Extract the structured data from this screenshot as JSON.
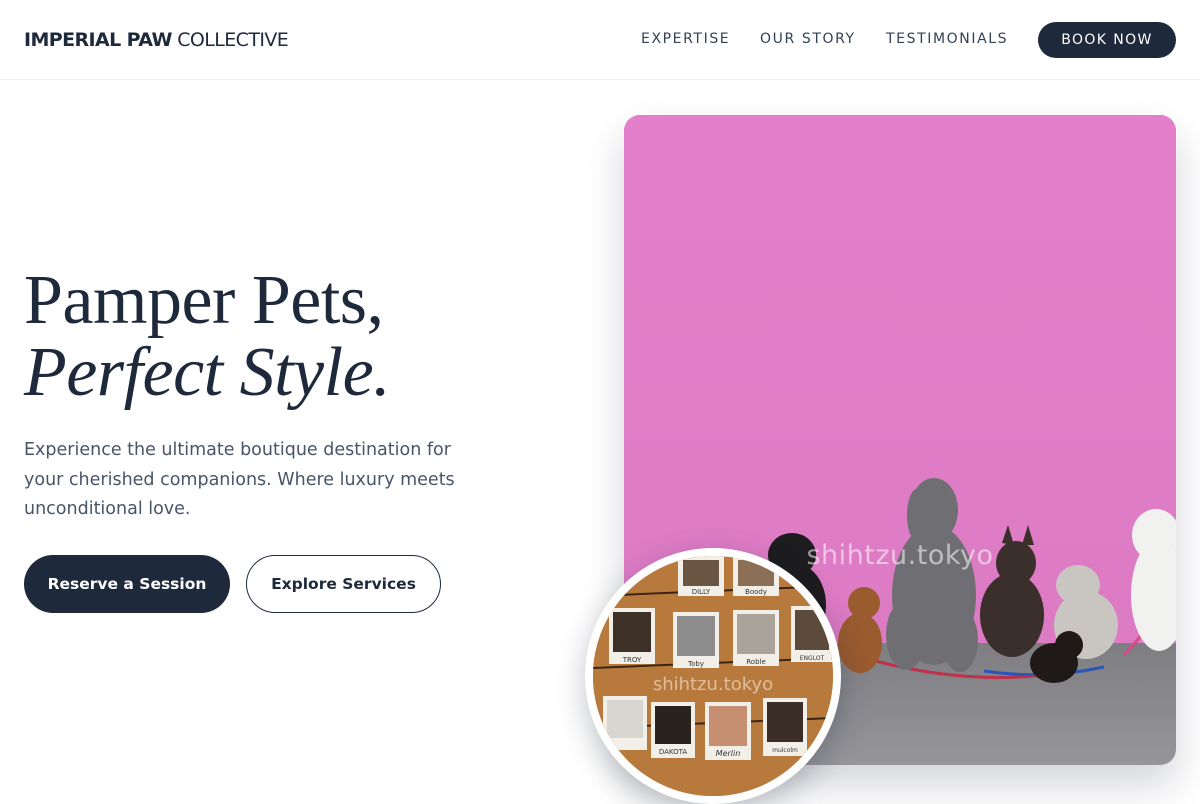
{
  "header": {
    "logo_strong": "IMPERIAL PAW",
    "logo_light": "COLLECTIVE",
    "nav": [
      {
        "label": "EXPERTISE"
      },
      {
        "label": "OUR STORY"
      },
      {
        "label": "TESTIMONIALS"
      }
    ],
    "cta_label": "BOOK NOW"
  },
  "hero": {
    "headline_line1": "Pamper Pets,",
    "headline_line2": "Perfect Style.",
    "subtext": "Experience the ultimate boutique destination for your cherished companions. Where luxury meets unconditional love.",
    "primary_button": "Reserve a Session",
    "secondary_button": "Explore Services",
    "image_watermark": "shihtzu.tokyo",
    "inset_watermark": "shihtzu.tokyo"
  },
  "polaroids": [
    "DILLY",
    "Boody",
    "TROY",
    "Toby",
    "Roble",
    "DAKOTA",
    "Merlin",
    "mulcolm",
    "ENGLOT"
  ],
  "colors": {
    "primary": "#1e293b",
    "wall_pink": "#e07fc8",
    "ground_gray": "#8a8a8e",
    "board_wood": "#b5793a"
  }
}
